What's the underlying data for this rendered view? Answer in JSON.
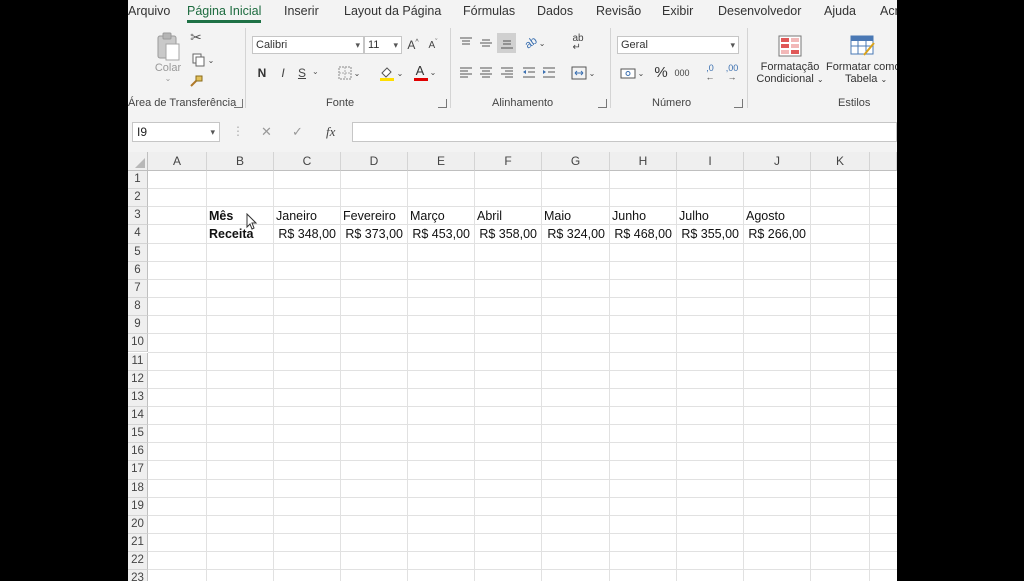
{
  "menu": {
    "tabs": [
      "Arquivo",
      "Página Inicial",
      "Inserir",
      "Layout da Página",
      "Fórmulas",
      "Dados",
      "Revisão",
      "Exibir",
      "Desenvolvedor",
      "Ajuda",
      "Acr"
    ]
  },
  "ribbon": {
    "clipboard": {
      "paste_label": "Colar",
      "group_label": "Área de Transferência"
    },
    "font": {
      "font_name": "Calibri",
      "font_size": "11",
      "bold": "N",
      "italic": "I",
      "underline": "S",
      "grow": "A",
      "shrink": "A",
      "font_color_letter": "A",
      "group_label": "Fonte"
    },
    "alignment": {
      "group_label": "Alinhamento"
    },
    "number": {
      "format": "Geral",
      "percent": "%",
      "thousands": "000",
      "inc_decimal": ",0",
      "dec_decimal": ",00",
      "group_label": "Número"
    },
    "styles": {
      "conditional_line1": "Formatação",
      "conditional_line2": "Condicional",
      "table_line1": "Formatar como",
      "table_line2": "Tabela",
      "group_label": "Estilos"
    }
  },
  "formula_bar": {
    "name_box": "I9",
    "cancel": "✕",
    "enter": "✓",
    "fx": "fx",
    "value": ""
  },
  "sheet": {
    "columns": [
      "A",
      "B",
      "C",
      "D",
      "E",
      "F",
      "G",
      "H",
      "I",
      "J",
      "K"
    ],
    "rows": [
      "1",
      "2",
      "3",
      "4",
      "5",
      "6",
      "7",
      "8",
      "9",
      "10",
      "11",
      "12",
      "13",
      "14",
      "15",
      "16",
      "17",
      "18",
      "19",
      "20",
      "21",
      "22",
      "23"
    ],
    "row3": [
      "Mês",
      "Janeiro",
      "Fevereiro",
      "Março",
      "Abril",
      "Maio",
      "Junho",
      "Julho",
      "Agosto"
    ],
    "row4": [
      "Receita",
      "R$ 348,00",
      "R$ 373,00",
      "R$ 453,00",
      "R$ 358,00",
      "R$ 324,00",
      "R$ 468,00",
      "R$ 355,00",
      "R$ 266,00"
    ]
  }
}
